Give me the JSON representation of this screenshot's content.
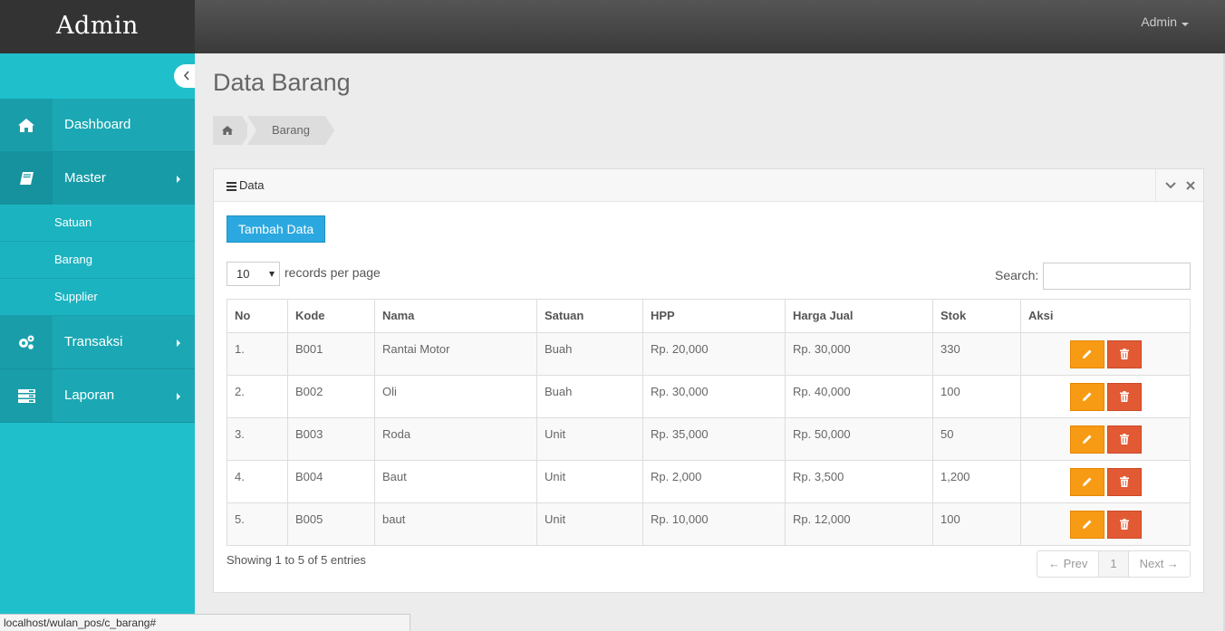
{
  "app": {
    "brand": "Admin",
    "user_label": "Admin"
  },
  "sidebar": {
    "items": [
      {
        "label": "Dashboard",
        "icon": "home-icon"
      },
      {
        "label": "Master",
        "icon": "book-icon"
      },
      {
        "label": "Transaksi",
        "icon": "gears-icon"
      },
      {
        "label": "Laporan",
        "icon": "list-icon"
      }
    ],
    "subitems": [
      "Satuan",
      "Barang",
      "Supplier"
    ]
  },
  "page": {
    "title": "Data Barang",
    "breadcrumb": "Barang"
  },
  "panel": {
    "title": "Data",
    "add_button": "Tambah Data"
  },
  "table_controls": {
    "page_size": "10",
    "records_label": "records per page",
    "search_label": "Search:"
  },
  "table": {
    "columns": [
      "No",
      "Kode",
      "Nama",
      "Satuan",
      "HPP",
      "Harga Jual",
      "Stok",
      "Aksi"
    ],
    "rows": [
      [
        "1.",
        "B001",
        "Rantai Motor",
        "Buah",
        "Rp. 20,000",
        "Rp. 30,000",
        "330"
      ],
      [
        "2.",
        "B002",
        "Oli",
        "Buah",
        "Rp. 30,000",
        "Rp. 40,000",
        "100"
      ],
      [
        "3.",
        "B003",
        "Roda",
        "Unit",
        "Rp. 35,000",
        "Rp. 50,000",
        "50"
      ],
      [
        "4.",
        "B004",
        "Baut",
        "Unit",
        "Rp. 2,000",
        "Rp. 3,500",
        "1,200"
      ],
      [
        "5.",
        "B005",
        "baut",
        "Unit",
        "Rp. 10,000",
        "Rp. 12,000",
        "100"
      ]
    ]
  },
  "footer": {
    "info": "Showing 1 to 5 of 5 entries",
    "prev": "← Prev",
    "page": "1",
    "next": "Next →"
  },
  "statusbar": {
    "url": "localhost/wulan_pos/c_barang#"
  },
  "colors": {
    "sidebar": "#1fbfcc",
    "primary": "#2ba8e0",
    "edit": "#f89b14",
    "delete": "#e25a34"
  }
}
